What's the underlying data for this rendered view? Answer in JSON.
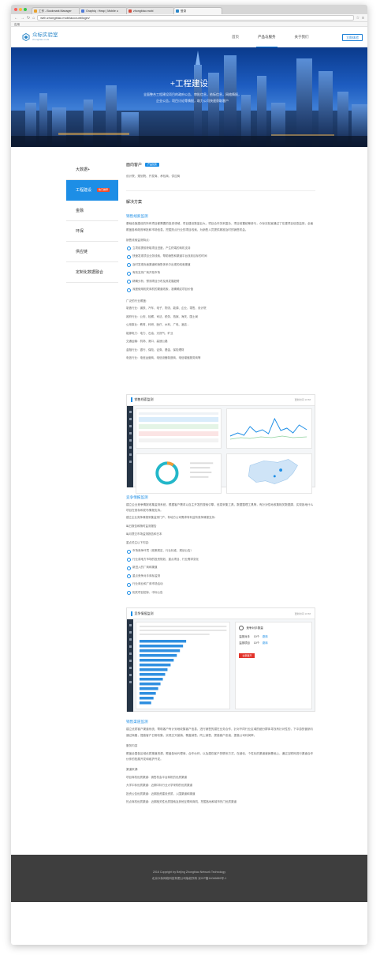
{
  "browser": {
    "tabs": [
      {
        "label": "工作 - Bookmark Manager",
        "color": "#e7a12d"
      },
      {
        "label": "Graphiq : Heap | Mobile u",
        "color": "#4f7ad8"
      },
      {
        "label": "zhongbiao.mobi",
        "color": "#d64a3a"
      },
      {
        "label": "登录",
        "color": "#2a86c8"
      }
    ],
    "url": "web.zhongbiao.mobi/account/login/",
    "bookmarks": "应用"
  },
  "site": {
    "logo_text": "众标实验室",
    "logo_sub": "zhongbiao mobi",
    "nav": [
      "首页",
      "产品与服务",
      "关于我们"
    ],
    "login": "立即体验"
  },
  "banner": {
    "title": "+工程建设",
    "desc": "全面整合工程建设项目的政府公告、审批信息，依标信息，网络情报，企业公告，项目讨论等情报，助力公司快速获取客户"
  },
  "sidebar": {
    "items": [
      "大数据+",
      "工程建设",
      "金融",
      "环保",
      "供应链",
      "定制化数据融合"
    ],
    "badge": "热门推荐"
  },
  "content": {
    "customer_title": "面向客户",
    "customer_tag": "产品优势",
    "customer_list": "设计院、规划院、开发商、承包商、供应商",
    "solution_title": "解决方案",
    "sales_title": "销售线索监测",
    "sales_desc": "基础设施建设的所有项目都需要的投资领域，项目建设数量巨大，项目合作关系复杂，项目前置统筹参与，众标实验室通过了在建项目信息监测，全面覆盖各种政府审批和市场信息，挖掘热点行业的项目线索，为销售人员提供精准及时的销售机会。",
    "features_label": "销售线索监测特点:",
    "features": [
      "立项前提前获取项目进度，产生终端的商机支持",
      "快速发现项目业务线索，帮助销售和渠道平台找到目标的时间",
      "及时发现负面渠道和销售体系中出现的线索渠道",
      "有效支持厂商开拓市场",
      "精确分析，预测项目分布及其发展趋势",
      "深度使用相关商机的渠道线索，准确确定项目价值"
    ],
    "industries_label": "广泛的行业覆盖:",
    "industries": [
      "制造行业：钢铁、汽车、电子、物流、能源、企业、零售、设计院",
      "政府行业：公安、检察、司法、税务、档案、海关、国土局",
      "公用事业：教育、科研、医疗、水利、广电、酒店...",
      "能源电力：电力、石油、天然气、矿业",
      "交通运输：机场、港口、高速公路",
      "金融行业：银行、保险、证券、基金、保险理财",
      "电信行业：电信运营商、电信设备制造商、电信增值服务商等"
    ],
    "shot1_title": "销售线索监测",
    "shot1_time": "更新时间 10:58",
    "comp_title": "竞争情报监测",
    "comp_desc": "建立企业竞争情报收集监测系统，根据客户需求以自主开发的搜索引擎，信息采集工具，数据整理工具等，有针对性地收集相关数据源，实现各地什么项目在竞标和发布情报支持。",
    "comp_lines": [
      "建立企业竞争情报采集监测门户，有地方公司需求有利益有竞争情报支持：",
      "每日报告和随时监测报告",
      "每月提交市场监测报告和日本"
    ],
    "comp_list_label": "重点关注以下内容:",
    "comp_list": [
      "市场竞争环境（政策规定、行业标准、规划公告）",
      "行业或地方市场的投资规划、重点项目、行业需求变化",
      "新进入的厂商和渠道",
      "重点竞争对手商标监测",
      "行业商业和厂商市场活动",
      "相关项目招标、中标公告"
    ],
    "shot2_title": "竞争情报监测",
    "shot2_time": "更新时间 10:58",
    "shot2_company": "竞争对手数量",
    "shot2_rows": [
      {
        "label": "监测对手",
        "value": "10个",
        "link": "跳转"
      },
      {
        "label": "监测项目",
        "value": "10个",
        "link": "跳转"
      }
    ],
    "shot2_btn": "全部展开",
    "channel_title": "销售渠道监测",
    "channel_desc": "建立优质客户渠道系统，帮助客户有计划地收集客户信息，进行销售的潜在业务合作，针对不同行业区域的细分群体寻找有针对性的，下中游的营销与通过商路，提高客户日常收集，实现交叉营销，覆盖销售，同上销售，提高客户忠诚，提高公司利润率。",
    "channel_content_label": "服务内容",
    "channel_content": "覆盖全国各区域优质渠道资源，覆盖各地代理商、合作伙伴，以及潜在客户的联系方式，在细化、个性化的渠道营销基础上，通过互联网进行渠道合作伙伴的拓展开发和维护开发。",
    "channel_source_label": "渠道来源:",
    "channel_sources": [
      "项目商机优质渠道：销售机会平台商机的优质渠道",
      "大学中标优质渠道：近期中标行业大学采购的优质渠道",
      "投资公告优质渠道：近期投资建设资质，入围渠道和渠道",
      "热点商机优质渠道：近期相关性优质搜索及其他互联网商机，挖掘各地和城市热门优质渠道"
    ]
  },
  "footer": {
    "copyright": "2016 Copyright by Beijing Zhongbiao Network Technology",
    "icp": "北京众标网络科技有限公司版权所有 京ICP备14046889号-1"
  }
}
